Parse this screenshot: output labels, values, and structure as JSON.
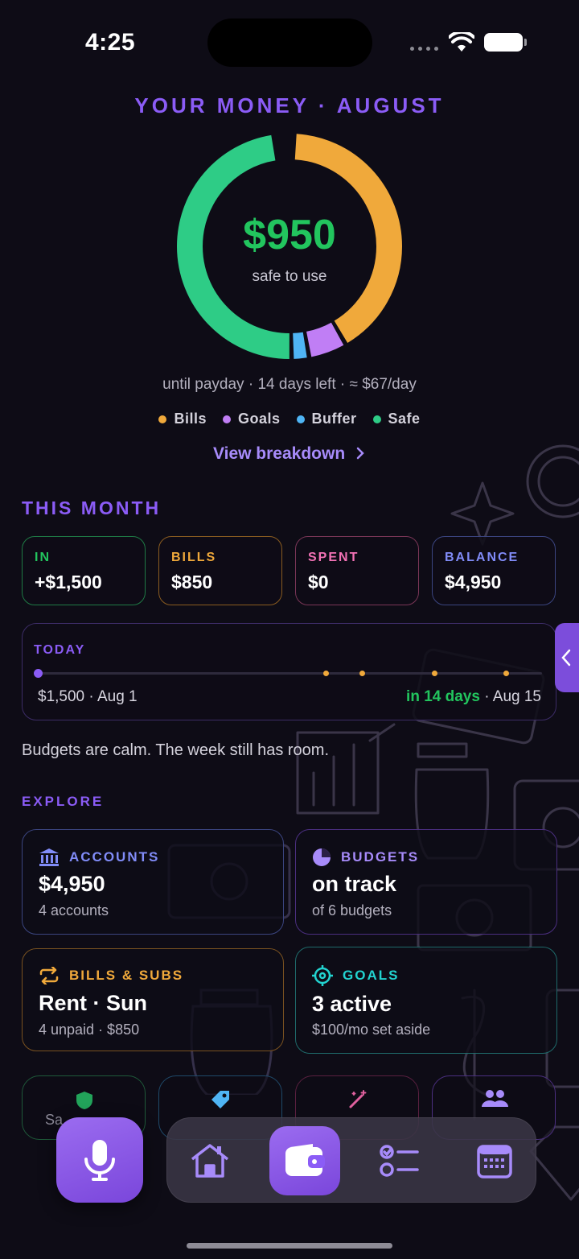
{
  "status_bar": {
    "time": "4:25"
  },
  "header": {
    "title": "YOUR MONEY · AUGUST"
  },
  "donut": {
    "amount": "$950",
    "caption": "safe to use",
    "segments": [
      {
        "name": "Bills",
        "fraction": 0.41,
        "color": "#f0a93b"
      },
      {
        "name": "Goals",
        "fraction": 0.055,
        "color": "#c07ef5"
      },
      {
        "name": "Buffer",
        "fraction": 0.025,
        "color": "#4fb5f5"
      },
      {
        "name": "Safe",
        "fraction": 0.48,
        "color": "#2ecc86"
      }
    ]
  },
  "payday_line": "until payday · 14 days left · ≈ $67/day",
  "legend": [
    {
      "label": "Bills",
      "color": "#f0a93b"
    },
    {
      "label": "Goals",
      "color": "#c07ef5"
    },
    {
      "label": "Buffer",
      "color": "#4fb5f5"
    },
    {
      "label": "Safe",
      "color": "#2ecc86"
    }
  ],
  "view_breakdown": "View breakdown",
  "this_month": {
    "title": "THIS MONTH",
    "stats": [
      {
        "label": "IN",
        "value": "+$1,500",
        "color": "#22c55e"
      },
      {
        "label": "BILLS",
        "value": "$850",
        "color": "#f0a93b"
      },
      {
        "label": "SPENT",
        "value": "$0",
        "color": "#f472b6"
      },
      {
        "label": "BALANCE",
        "value": "$4,950",
        "color": "#818cf8"
      }
    ]
  },
  "today": {
    "label": "TODAY",
    "left_text": "$1,500 · Aug 1",
    "right_highlight": "in 14 days",
    "right_text": " · Aug 15"
  },
  "calm_text": "Budgets are calm. The week still has room.",
  "explore": {
    "title": "EXPLORE",
    "cards": [
      {
        "title": "ACCOUNTS",
        "big": "$4,950",
        "small": "4 accounts",
        "color": "#818cf8",
        "icon": "bank-icon"
      },
      {
        "title": "BUDGETS",
        "big": "on track",
        "small": "of 6 budgets",
        "color": "#a78bfa",
        "icon": "pie-chart-icon"
      },
      {
        "title": "BILLS & SUBS",
        "big": "Rent · Sun",
        "small": "4 unpaid · $850",
        "color": "#f0a93b",
        "icon": "repeat-icon"
      },
      {
        "title": "GOALS",
        "big": "3 active",
        "small": "$100/mo set aside",
        "color": "#22d3d0",
        "icon": "target-icon"
      }
    ],
    "mini_partial_label": "Sa"
  },
  "dock": {
    "mic": "microphone-icon",
    "items": [
      "home-icon",
      "wallet-icon",
      "checklist-icon",
      "calendar-icon"
    ],
    "active": "wallet-icon"
  }
}
